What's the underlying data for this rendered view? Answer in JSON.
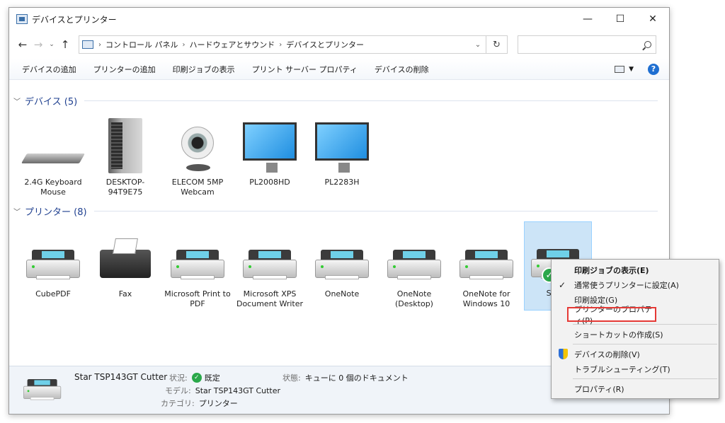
{
  "window": {
    "title": "デバイスとプリンター",
    "minimize": "—",
    "maximize": "☐",
    "close": "✕"
  },
  "nav": {
    "back": "←",
    "forward": "→",
    "recent": "⌄",
    "up": "↑",
    "refresh": "↻"
  },
  "breadcrumb": [
    "コントロール パネル",
    "ハードウェアとサウンド",
    "デバイスとプリンター"
  ],
  "search": {
    "placeholder": ""
  },
  "commands": [
    "デバイスの追加",
    "プリンターの追加",
    "印刷ジョブの表示",
    "プリント サーバー プロパティ",
    "デバイスの削除"
  ],
  "groups": {
    "devices": {
      "label": "デバイス (5)"
    },
    "printers": {
      "label": "プリンター (8)"
    }
  },
  "devices": [
    {
      "label": "2.4G Keyboard Mouse",
      "icon": "keyboard-icon"
    },
    {
      "label": "DESKTOP-94T9E75",
      "icon": "computer-tower-icon"
    },
    {
      "label": "ELECOM 5MP Webcam",
      "icon": "webcam-icon"
    },
    {
      "label": "PL2008HD",
      "icon": "monitor-icon"
    },
    {
      "label": "PL2283H",
      "icon": "monitor-icon"
    }
  ],
  "printers": [
    {
      "label": "CubePDF",
      "icon": "printer-icon"
    },
    {
      "label": "Fax",
      "icon": "fax-icon"
    },
    {
      "label": "Microsoft Print to PDF",
      "icon": "printer-icon"
    },
    {
      "label": "Microsoft XPS Document Writer",
      "icon": "printer-icon"
    },
    {
      "label": "OneNote",
      "icon": "printer-icon"
    },
    {
      "label": "OneNote (Desktop)",
      "icon": "printer-icon"
    },
    {
      "label": "OneNote for Windows 10",
      "icon": "printer-icon"
    },
    {
      "label": "Star T",
      "icon": "printer-icon",
      "selected": true
    }
  ],
  "default_check": "✓",
  "details": {
    "name": "Star TSP143GT Cutter",
    "status_key": "状況:",
    "status_value": "既定",
    "state_key": "状態:",
    "state_value": "キューに 0 個のドキュメント",
    "model_key": "モデル:",
    "model_value": "Star TSP143GT Cutter",
    "category_key": "カテゴリ:",
    "category_value": "プリンター"
  },
  "context_menu": {
    "items": [
      {
        "label": "印刷ジョブの表示(E)",
        "bold": true
      },
      {
        "label": "通常使うプリンターに設定(A)",
        "checked": true,
        "check": "✓"
      },
      {
        "label": "印刷設定(G)"
      },
      {
        "label": "プリンターのプロパティ(P)",
        "highlighted": true
      },
      {
        "label": "ショートカットの作成(S)"
      },
      {
        "label": "デバイスの削除(V)",
        "shield": true
      },
      {
        "label": "トラブルシューティング(T)"
      },
      {
        "label": "プロパティ(R)"
      }
    ]
  },
  "colors": {
    "accent": "#1e3f8f",
    "selection": "#cce4f7",
    "highlight_border": "#e53935"
  }
}
